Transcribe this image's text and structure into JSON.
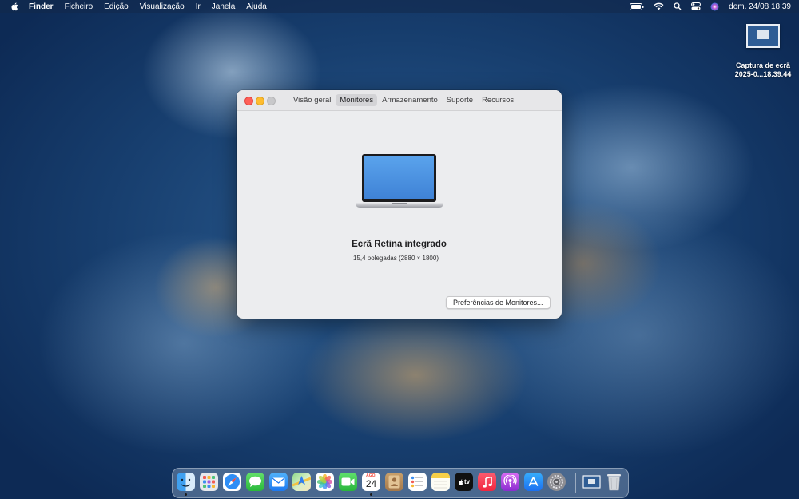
{
  "menubar": {
    "app_name": "Finder",
    "items": [
      "Ficheiro",
      "Edição",
      "Visualização",
      "Ir",
      "Janela",
      "Ajuda"
    ],
    "clock": "dom. 24/08  18:39"
  },
  "desktop": {
    "icons": [
      {
        "label_line1": "Captura de ecrã",
        "label_line2": "2025-0...18.39.44"
      }
    ]
  },
  "window": {
    "tabs": [
      "Visão geral",
      "Monitores",
      "Armazenamento",
      "Suporte",
      "Recursos"
    ],
    "active_tab": "Monitores",
    "display_name": "Ecrã Retina integrado",
    "display_size": "15,4 polegadas (2880 × 1800)",
    "prefs_button": "Preferências de Monitores..."
  },
  "dock": {
    "calendar_month": "AGO.",
    "calendar_day": "24",
    "tv_label": "tv",
    "items": [
      "finder",
      "launchpad",
      "safari",
      "messages",
      "mail",
      "maps",
      "photos",
      "facetime",
      "calendar",
      "contacts",
      "reminders",
      "notes",
      "tv",
      "music",
      "podcasts",
      "app-store",
      "system-preferences",
      "screenshot",
      "trash"
    ]
  },
  "colors": {
    "close": "#fe5f57",
    "minimize": "#febc2e",
    "zoom": "#c8c8ca",
    "screen_blue": "#4a8fe0"
  }
}
